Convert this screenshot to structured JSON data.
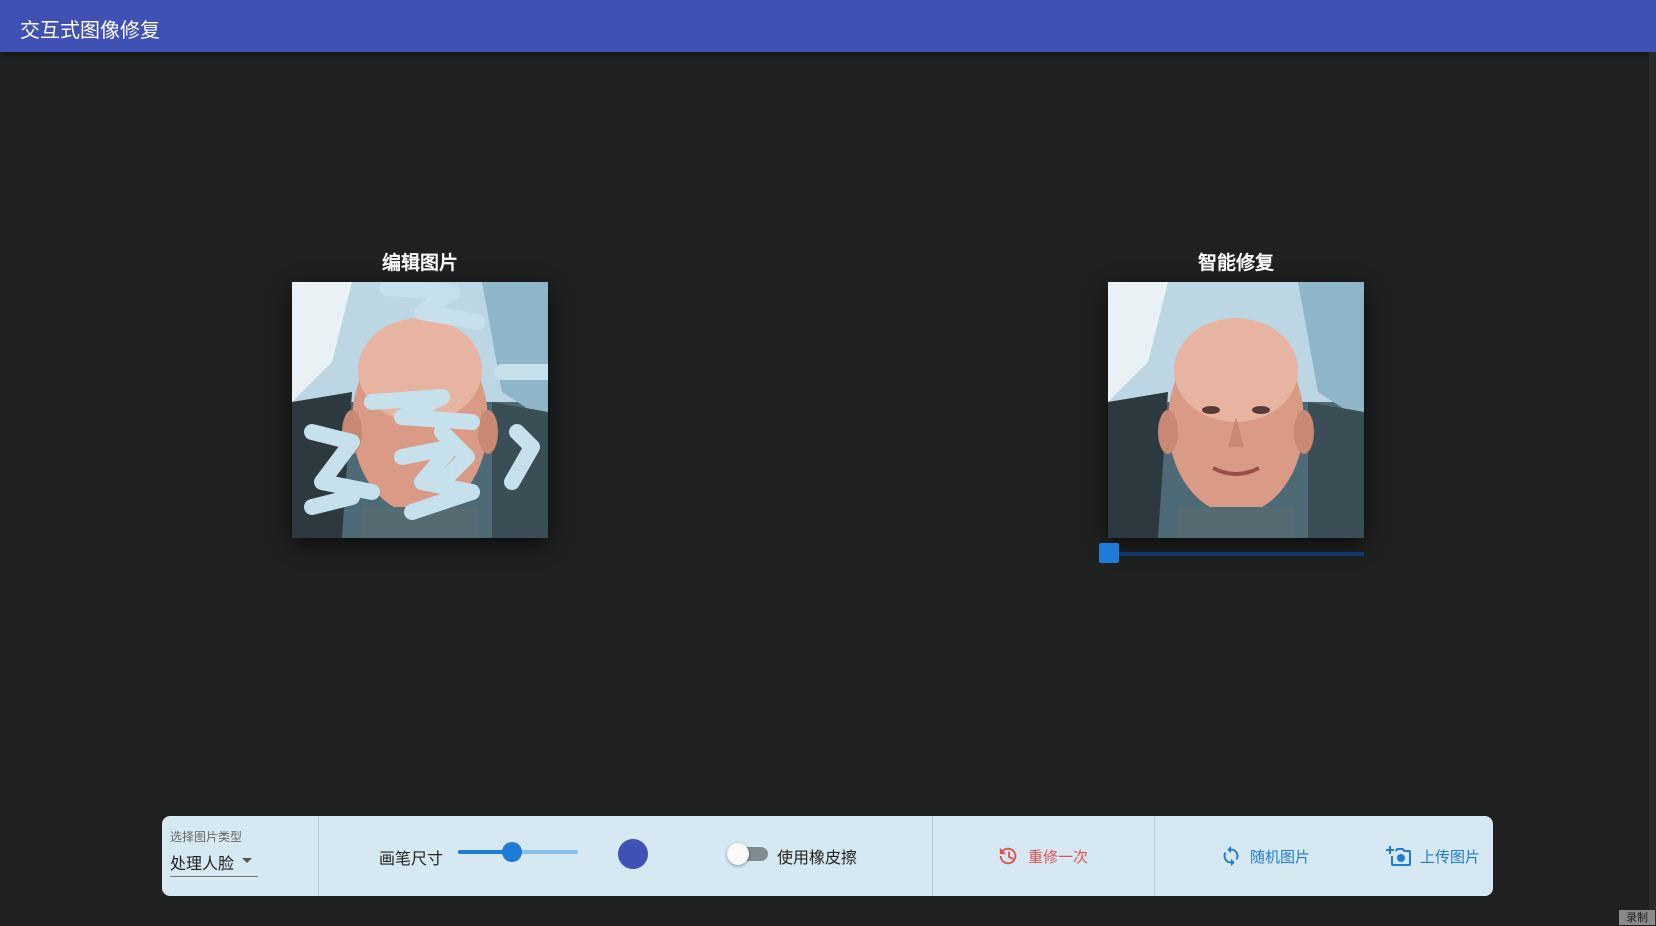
{
  "app": {
    "title": "交互式图像修复"
  },
  "panels": {
    "edit_title": "编辑图片",
    "repair_title": "智能修复"
  },
  "toolbar": {
    "select_label": "选择图片类型",
    "select_value": "处理人脸",
    "brush_label": "画笔尺寸",
    "brush_value_fraction": 0.45,
    "brush_color": "#3f51b5",
    "eraser_label": "使用橡皮擦",
    "eraser_on": false,
    "redo_label": "重修一次",
    "random_label": "随机图片",
    "upload_label": "上传图片"
  },
  "icons": {
    "redo": "history-icon",
    "random": "refresh-icon",
    "upload": "add-photo-icon"
  },
  "colors": {
    "appbar": "#3f51b5",
    "accent": "#1e7bd6",
    "danger": "#e05252"
  },
  "corner_button": "录制"
}
